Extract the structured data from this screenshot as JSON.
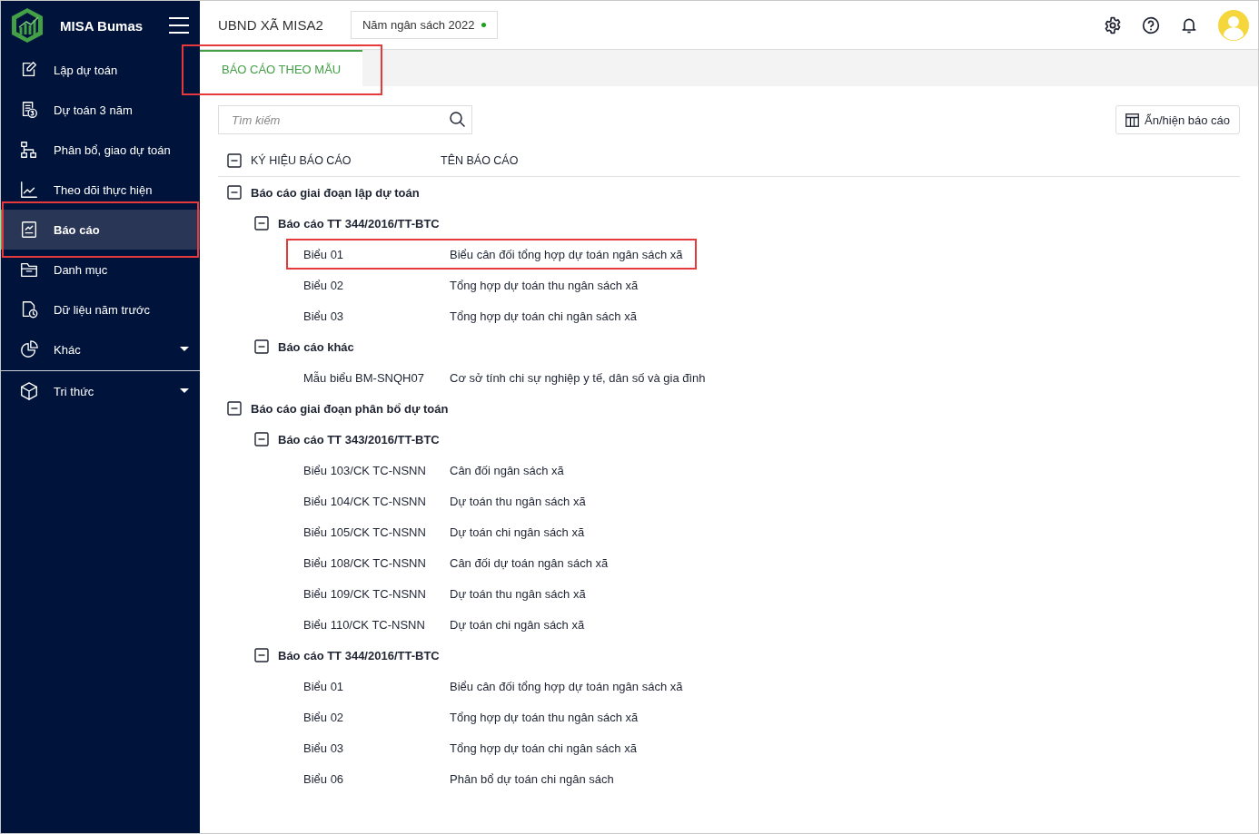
{
  "app": {
    "name": "MISA Bumas"
  },
  "sidebar": {
    "items": [
      {
        "label": "Lập dự toán",
        "selected": false,
        "annotated": false,
        "has_submenu": false
      },
      {
        "label": "Dự toán 3 năm",
        "selected": false,
        "annotated": false,
        "has_submenu": false
      },
      {
        "label": "Phân bổ, giao dự toán",
        "selected": false,
        "annotated": false,
        "has_submenu": false
      },
      {
        "label": "Theo dõi thực hiện",
        "selected": false,
        "annotated": false,
        "has_submenu": false
      },
      {
        "label": "Báo cáo",
        "selected": true,
        "annotated": true,
        "has_submenu": false
      },
      {
        "label": "Danh mục",
        "selected": false,
        "annotated": false,
        "has_submenu": false
      },
      {
        "label": "Dữ liệu năm trước",
        "selected": false,
        "annotated": false,
        "has_submenu": false
      },
      {
        "label": "Khác",
        "selected": false,
        "annotated": false,
        "has_submenu": true
      }
    ],
    "footer_items": [
      {
        "label": "Tri thức",
        "selected": false,
        "annotated": false,
        "has_submenu": true
      }
    ]
  },
  "header": {
    "organization": "UBND XÃ MISA2",
    "budget_year": "Năm ngân sách 2022"
  },
  "tabs": [
    {
      "label": "BÁO CÁO THEO MẪU",
      "selected": true,
      "annotated": true
    }
  ],
  "search": {
    "placeholder": "Tìm kiếm"
  },
  "toggle_button": {
    "label": "Ẩn/hiện báo cáo"
  },
  "table": {
    "columns": [
      "KÝ HIỆU BÁO CÁO",
      "TÊN BÁO CÁO"
    ],
    "header_expanded": true,
    "rows": [
      {
        "label": "Báo cáo giai đoạn lập dự toán",
        "expanded": true,
        "children": [
          {
            "label": "Báo cáo TT 344/2016/TT-BTC",
            "expanded": true,
            "children": [
              {
                "code": "Biểu 01",
                "name": "Biểu cân đối tổng hợp dự toán ngân sách xã",
                "annotated": true
              },
              {
                "code": "Biểu 02",
                "name": "Tổng hợp dự toán thu ngân sách xã",
                "annotated": false
              },
              {
                "code": "Biểu 03",
                "name": "Tổng hợp dự toán chi ngân sách xã",
                "annotated": false
              }
            ]
          },
          {
            "label": "Báo cáo khác",
            "expanded": true,
            "children": [
              {
                "code": "Mẫu biểu BM-SNQH07",
                "name": "Cơ sở tính chi sự nghiệp y tế, dân số và gia đình",
                "annotated": false
              }
            ]
          }
        ]
      },
      {
        "label": "Báo cáo giai đoạn phân bổ dự toán",
        "expanded": true,
        "children": [
          {
            "label": "Báo cáo TT 343/2016/TT-BTC",
            "expanded": true,
            "children": [
              {
                "code": "Biểu 103/CK TC-NSNN",
                "name": "Cân đối ngân sách xã",
                "annotated": false
              },
              {
                "code": "Biểu 104/CK TC-NSNN",
                "name": "Dự toán thu ngân sách xã",
                "annotated": false
              },
              {
                "code": "Biểu 105/CK TC-NSNN",
                "name": "Dự toán chi ngân sách xã",
                "annotated": false
              },
              {
                "code": "Biểu 108/CK TC-NSNN",
                "name": "Cân đối dự toán ngân sách xã",
                "annotated": false
              },
              {
                "code": "Biểu 109/CK TC-NSNN",
                "name": "Dự toán thu ngân sách xã",
                "annotated": false
              },
              {
                "code": "Biểu 110/CK TC-NSNN",
                "name": "Dự toán chi ngân sách xã",
                "annotated": false
              }
            ]
          },
          {
            "label": "Báo cáo TT 344/2016/TT-BTC",
            "expanded": true,
            "children": [
              {
                "code": "Biểu 01",
                "name": "Biểu cân đối tổng hợp dự toán ngân sách xã",
                "annotated": false
              },
              {
                "code": "Biểu 02",
                "name": "Tổng hợp dự toán thu ngân sách xã",
                "annotated": false
              },
              {
                "code": "Biểu 03",
                "name": "Tổng hợp dự toán chi ngân sách xã",
                "annotated": false
              },
              {
                "code": "Biểu 06",
                "name": "Phân bổ dự toán chi ngân sách",
                "annotated": false
              }
            ]
          }
        ]
      }
    ]
  }
}
